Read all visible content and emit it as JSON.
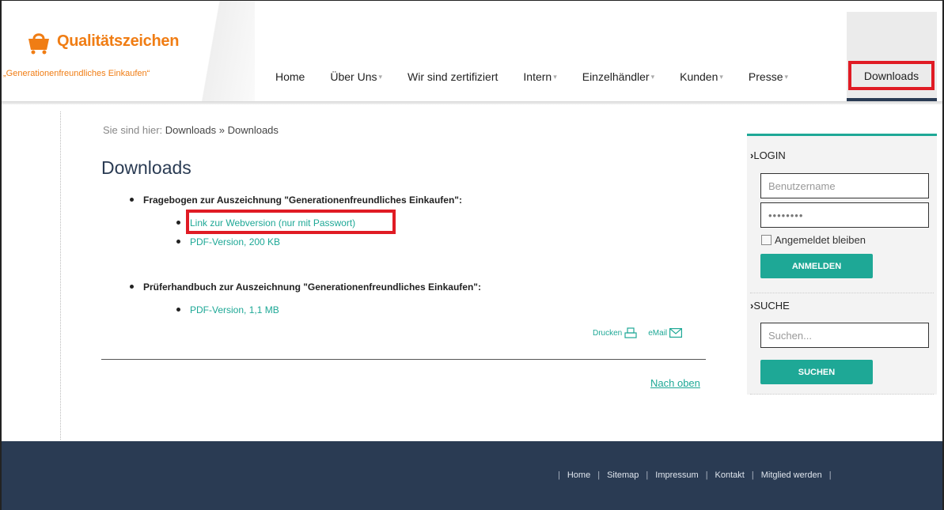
{
  "brand": {
    "title": "Qualitätszeichen",
    "subtitle": "„Generationenfreundliches Einkaufen“",
    "orange": "#f07d14"
  },
  "nav": {
    "items": [
      {
        "label": "Home",
        "caret": false
      },
      {
        "label": "Über Uns",
        "caret": true
      },
      {
        "label": "Wir sind zertifiziert",
        "caret": false
      },
      {
        "label": "Intern",
        "caret": true
      },
      {
        "label": "Einzelhändler",
        "caret": true
      },
      {
        "label": "Kunden",
        "caret": true
      },
      {
        "label": "Presse",
        "caret": true
      }
    ],
    "active": "Downloads"
  },
  "breadcrumb": {
    "prefix": "Sie sind hier:",
    "first": "Downloads",
    "separator": "»",
    "second": "Downloads"
  },
  "page": {
    "title": "Downloads",
    "sections": [
      {
        "heading": "Fragebogen zur Auszeichnung \"Generationenfreundliches Einkaufen\":",
        "links": [
          "Link zur Webversion (nur mit Passwort)",
          "PDF-Version, 200 KB"
        ]
      },
      {
        "heading": "Prüferhandbuch zur Auszeichnung \"Generationenfreundliches Einkaufen\":",
        "links": [
          "PDF-Version, 1,1 MB"
        ]
      }
    ],
    "print_label": "Drucken",
    "email_label": "eMail",
    "to_top": "Nach oben"
  },
  "sidebar": {
    "login_heading": "LOGIN",
    "username_placeholder": "Benutzername",
    "password_value": "••••••••",
    "remember_label": "Angemeldet bleiben",
    "login_button": "ANMELDEN",
    "search_heading": "SUCHE",
    "search_placeholder": "Suchen...",
    "search_button": "SUCHEN"
  },
  "footer": {
    "links": [
      "Home",
      "Sitemap",
      "Impressum",
      "Kontakt",
      "Mitglied werden"
    ]
  },
  "colors": {
    "accent": "#1ea896",
    "navy": "#2a3b53",
    "highlight": "#e01b24"
  }
}
